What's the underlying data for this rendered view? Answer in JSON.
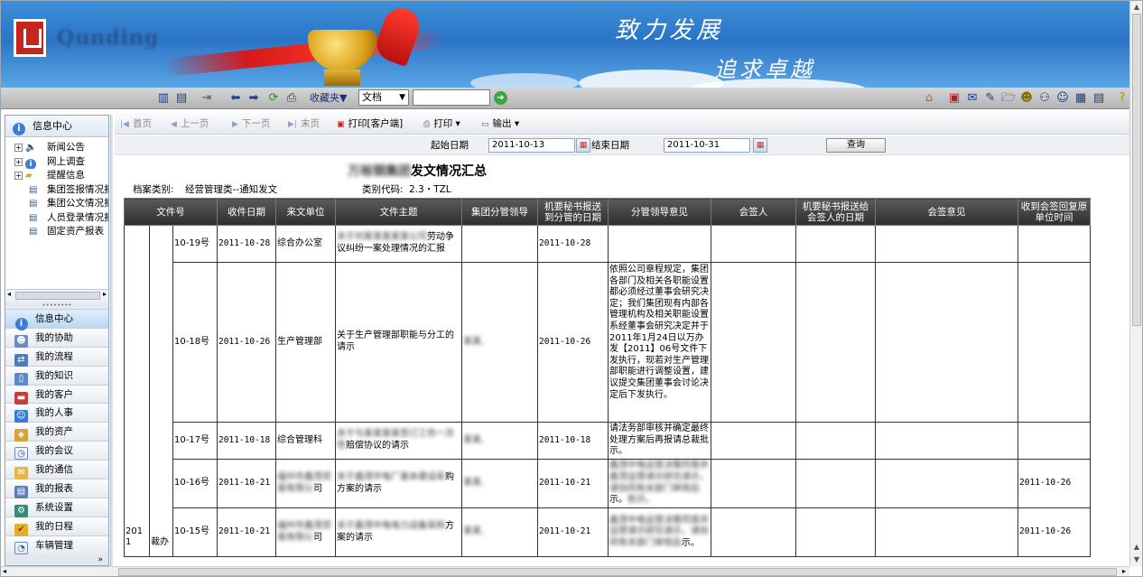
{
  "banner": {
    "logo_text": "Qunding",
    "slogan_line1": "致力发展",
    "slogan_line2": "追求卓越"
  },
  "toolbar": {
    "favorites_label": "收藏夹▼",
    "doc_select_value": "文档",
    "search_value": ""
  },
  "sidebar": {
    "header": "信息中心",
    "tree": [
      {
        "label": "新闻公告",
        "icon": "speaker-icon",
        "expandable": true
      },
      {
        "label": "网上调查",
        "icon": "info-icon",
        "expandable": true
      },
      {
        "label": "提醒信息",
        "icon": "folder-icon",
        "expandable": true
      },
      {
        "label": "集团签报情况报",
        "icon": "document-icon",
        "expandable": false
      },
      {
        "label": "集团公文情况报",
        "icon": "document-icon",
        "expandable": false
      },
      {
        "label": "人员登录情况报",
        "icon": "document-icon",
        "expandable": false
      },
      {
        "label": "固定资产报表",
        "icon": "document-icon",
        "expandable": false
      }
    ],
    "nav": [
      {
        "label": "信息中心",
        "icon": "info-icon",
        "active": true
      },
      {
        "label": "我的协助",
        "icon": "users-icon"
      },
      {
        "label": "我的流程",
        "icon": "flow-icon"
      },
      {
        "label": "我的知识",
        "icon": "book-icon"
      },
      {
        "label": "我的客户",
        "icon": "contact-card-icon"
      },
      {
        "label": "我的人事",
        "icon": "person-icon"
      },
      {
        "label": "我的资产",
        "icon": "assets-icon"
      },
      {
        "label": "我的会议",
        "icon": "meeting-icon"
      },
      {
        "label": "我的通信",
        "icon": "mail-icon"
      },
      {
        "label": "我的报表",
        "icon": "report-icon"
      },
      {
        "label": "系统设置",
        "icon": "settings-icon"
      },
      {
        "label": "我的日程",
        "icon": "calendar-check-icon"
      },
      {
        "label": "车辆管理",
        "icon": "car-icon"
      }
    ],
    "more": "»"
  },
  "content": {
    "nav_toolbar": {
      "first": "首页",
      "prev": "上一页",
      "next": "下一页",
      "last": "末页",
      "print_client": "打印[客户端]",
      "print": "打印 ▾",
      "export": "输出 ▾"
    },
    "date_bar": {
      "start_label": "起始日期",
      "start_value": "2011-10-13",
      "end_label": "结束日期",
      "end_value": "2011-10-31",
      "query_button": "查询"
    },
    "report": {
      "title_blurred": "万裕钢集团",
      "title": "发文情况汇总",
      "category_label": "档案类别:",
      "category_value": "经营管理类--通知发文",
      "code_label": "类别代码:",
      "code_value": "2.3・TZL"
    },
    "table": {
      "headers": [
        "文件号",
        "收件日期",
        "来文单位",
        "文件主题",
        "集团分管领导",
        "机要秘书报送到分管的日期",
        "分管领导意见",
        "会签人",
        "机要秘书报送给会签人的日期",
        "会签意见",
        "收到会签回复原单位时间"
      ],
      "year": "2011",
      "dept": "裁办",
      "rows": [
        {
          "doc_no": "10-19号",
          "received": "2011-10-28",
          "from_unit": "综合办公室",
          "from_unit_blur": "",
          "subject_blur": "关于刘某某某某某公司",
          "subject": "劳动争议纠纷一案处理情况的汇报",
          "leader": "",
          "sent_date": "2011-10-28",
          "opinion": "",
          "opinion_blur": "",
          "cosign_reply": ""
        },
        {
          "doc_no": "10-18号",
          "received": "2011-10-26",
          "from_unit": "生产管理部",
          "from_unit_blur": "",
          "subject_blur": "",
          "subject": "关于生产管理部职能与分工的请示",
          "leader": "某某,",
          "sent_date": "2011-10-26",
          "opinion": "依照公司章程规定，集团各部门及相关各职能设置都必须经过董事会研究决定；我们集团现有内部各管理机构及相关职能设置系经董事会研究决定并于2011年1月24日以万办发【2011】06号文件下发执行，现若对生产管理部职能进行调整设置，建议提交集团董事会讨论决定后下发执行。",
          "opinion_blur": "",
          "cosign_reply": ""
        },
        {
          "doc_no": "10-17号",
          "received": "2011-10-18",
          "from_unit": "综合管理科",
          "from_unit_blur": "",
          "subject_blur": "关于与某某某某签订工伤一次性",
          "subject": "赔偿协议的请示",
          "leader": "某某,",
          "sent_date": "2011-10-18",
          "opinion": "请法务部审核并确定最终处理方案后再报请总裁批示。",
          "opinion_blur": "",
          "cosign_reply": ""
        },
        {
          "doc_no": "10-16号",
          "received": "2011-10-21",
          "from_unit": "司",
          "from_unit_blur": "福州市鑫茂贸易有限公",
          "subject_blur": "关于鑫茂中电厂基本建设采",
          "subject": "购方案的请示",
          "leader": "某某,",
          "sent_date": "2011-10-21",
          "opinion": "示。",
          "opinion_blur": "鑫茂中电运营决策同意并鑫茂运营请示研究请示，请协同有关部门审核后",
          "opinion_tail": "批示。",
          "cosign_reply": "2011-10-26"
        },
        {
          "doc_no": "10-15号",
          "received": "2011-10-21",
          "from_unit": "司",
          "from_unit_blur": "福州市鑫茂贸易有限公",
          "subject_blur": "关于鑫茂中电电力设备采购",
          "subject": "方案的请示",
          "leader": "某某,",
          "sent_date": "2011-10-21",
          "opinion": "示。",
          "opinion_blur": "鑫茂中电运营决策同意并运营请示研究请示，请协同有关部门审核后",
          "opinion_tail": "",
          "cosign_reply": "2011-10-26"
        }
      ]
    }
  }
}
